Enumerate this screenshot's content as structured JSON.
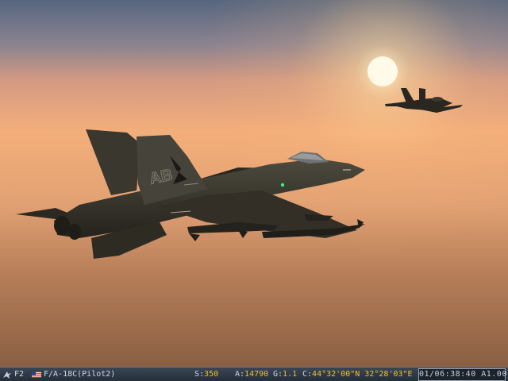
{
  "hud": {
    "view_key": "F2",
    "view_icon": "external-view-icon",
    "flag_icon": "us-flag-icon",
    "aircraft": "F/A-18C(Pilot2)",
    "speed_label": "S:",
    "speed_value": "350",
    "alt_label": "A:",
    "alt_value": "14790",
    "g_label": "G:",
    "g_value": "1.1",
    "coord_label": "C:",
    "coord_value": "44°32'00\"N  32°28'03\"E",
    "clock": "01/06:38:40 A1.00"
  },
  "scene": {
    "description_icons": [
      "sun-icon",
      "lead-fighter-jet",
      "wingman-fighter-jet"
    ],
    "sky_colors": [
      "#5e6f85",
      "#c28a7e",
      "#f1b98a",
      "#c98a58",
      "#8f6448"
    ],
    "tail_markings": "AB"
  }
}
